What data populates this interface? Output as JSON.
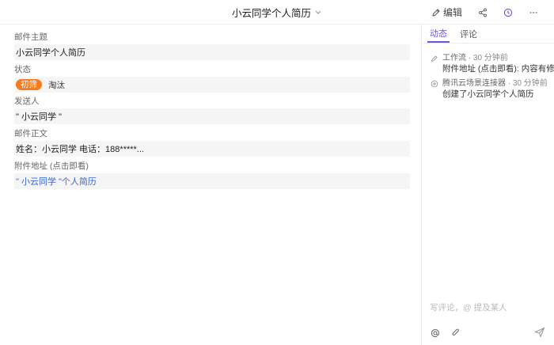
{
  "header": {
    "title": "小云同学个人简历",
    "edit_label": "编辑"
  },
  "fields": [
    {
      "label": "邮件主题",
      "value": "小云同学个人简历"
    },
    {
      "label": "状态",
      "tags": [
        "初筛",
        "淘汰"
      ]
    },
    {
      "label": "发送人",
      "value": "\" 小云同学 \""
    },
    {
      "label": "邮件正文",
      "value": "姓名：小云同学 电话：188*****..."
    },
    {
      "label": "附件地址 (点击即看)",
      "value": "\" 小云同学 \"个人简历"
    }
  ],
  "side": {
    "tabs": [
      "动态",
      "评论"
    ],
    "activities": [
      {
        "who": "工作流",
        "when": " · 30 分钟前",
        "text": "附件地址 (点击即看): 内容有修改"
      },
      {
        "who": "腾讯云场景连接器",
        "when": " · 30 分钟前",
        "text": "创建了小云同学个人简历"
      }
    ],
    "comment_placeholder": "写评论，@ 提及某人"
  },
  "colors": {
    "accent": "#6a56d8",
    "status_tag": "#f47b20",
    "link": "#3c68c8"
  }
}
